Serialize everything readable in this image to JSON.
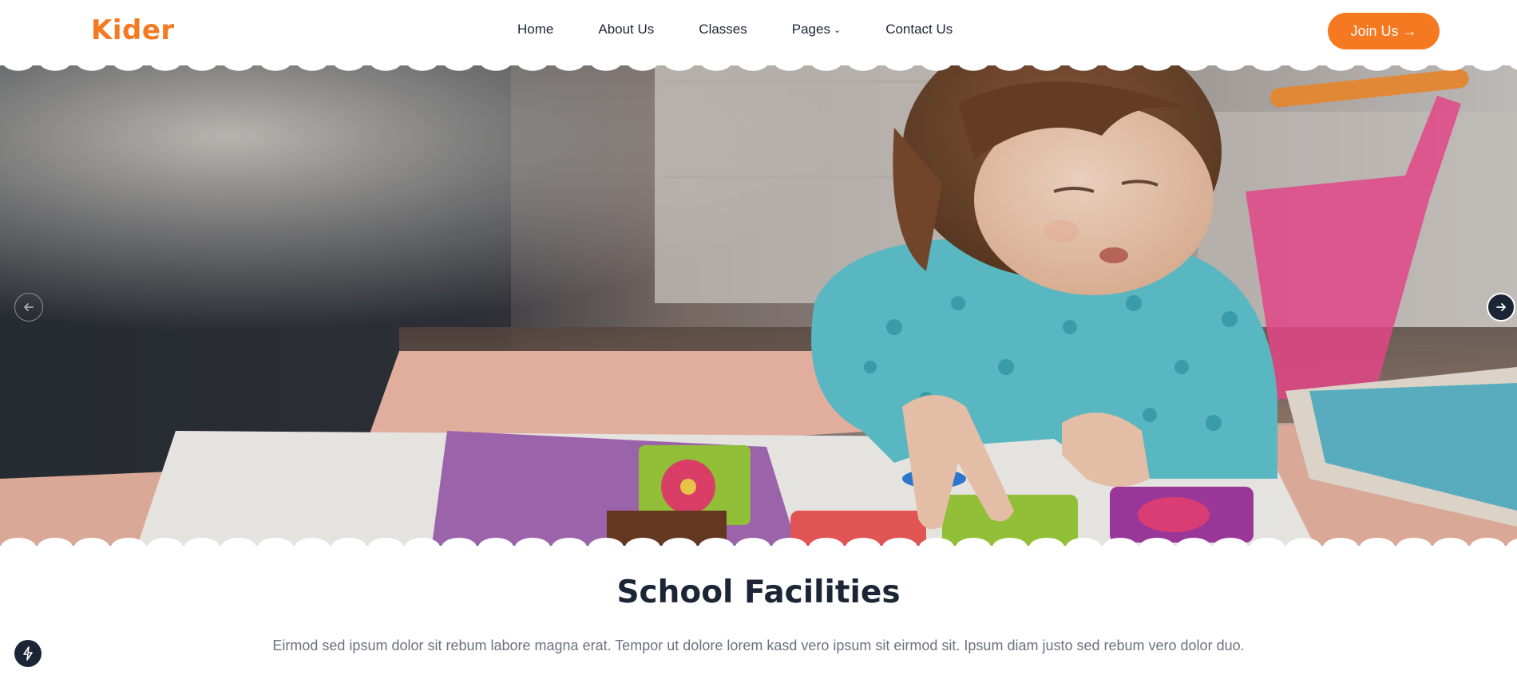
{
  "brand": {
    "name": "Kider",
    "color": "#f47920"
  },
  "nav": {
    "items": [
      {
        "label": "Home"
      },
      {
        "label": "About Us"
      },
      {
        "label": "Classes"
      },
      {
        "label": "Pages",
        "has_dropdown": true,
        "icon": "chevron-down-icon"
      },
      {
        "label": "Contact Us"
      }
    ],
    "cta_label": "Join Us →"
  },
  "hero": {
    "image_description": "",
    "prev_icon": "arrow-left-icon",
    "next_icon": "arrow-right-icon"
  },
  "section": {
    "title": "School Facilities",
    "description": "Eirmod sed ipsum dolor sit rebum labore magna erat. Tempor ut dolore lorem kasd vero ipsum sit eirmod sit. Ipsum diam justo sed rebum vero dolor duo."
  },
  "widget": {
    "icon": "bolt-icon"
  },
  "colors": {
    "accent": "#f47920",
    "dark": "#1b2535",
    "muted": "#6b7280"
  }
}
